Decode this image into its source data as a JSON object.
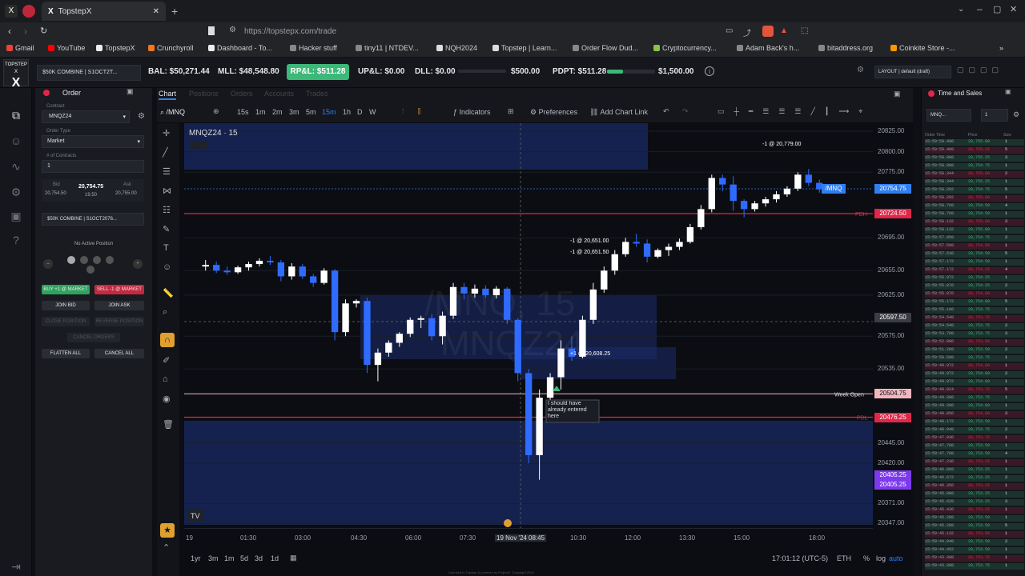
{
  "browser": {
    "tabs": [
      {
        "label": "TopstepX",
        "active": true
      }
    ],
    "url": "https://topstepx.com/trade",
    "bookmarks": [
      "Gmail",
      "YouTube",
      "TopstepX",
      "Crunchyroll",
      "Dashboard - To...",
      "Hacker stuff",
      "tiny11 | NTDEV...",
      "NQH2024",
      "Topstep | Learn...",
      "Order Flow Dud...",
      "Cryptocurrency...",
      "Adam Back's h...",
      "bitaddress.org",
      "Coinkite Store -..."
    ]
  },
  "appbar": {
    "logo": "TOPSTEP X",
    "account": "$50K COMBINE | S1OCT2T...",
    "bal": "BAL: $50,271.44",
    "mll": "MLL: $48,548.80",
    "rpl": "RP&L: $511.28",
    "upl": "UP&L: $0.00",
    "dll": "DLL: $0.00",
    "dll_limit": "$500.00",
    "pdpt": "PDPT: $511.28",
    "pdpt_target": "$1,500.00",
    "pdpt_progress": 0.34,
    "layout": "LAYOUT | default (draft)"
  },
  "order": {
    "title": "Order",
    "contract_label": "Contract",
    "contract": "MNQZ24",
    "order_type_label": "Order Type",
    "order_type": "Market",
    "qty_label": "# of Contracts",
    "qty": "1",
    "bid_label": "Bid",
    "bid": "20,754.50",
    "last": "20,754.75",
    "last_size": "19.50",
    "ask_label": "Ask",
    "ask": "20,755.00",
    "account": "$50K COMBINE | S1OCT2076...",
    "position": "No Active Position",
    "buy_btn": "BUY +1 @ MARKET",
    "sell_btn": "SELL -1 @ MARKET",
    "join_bid": "JOIN BID",
    "join_ask": "JOIN ASK",
    "close_pos": "CLOSE POSITION",
    "reverse_pos": "REVERSE POSITION",
    "cancel_orders": "CANCEL ORDERS",
    "flatten_all": "FLATTEN ALL",
    "cancel_all": "CANCEL ALL"
  },
  "chart": {
    "tabs": [
      "Chart",
      "Positions",
      "Orders",
      "Accounts",
      "Trades"
    ],
    "symbol": "/MNQ",
    "timeframes": [
      "15s",
      "1m",
      "2m",
      "3m",
      "5m",
      "15m",
      "1h",
      "D",
      "W"
    ],
    "indicators_label": "Indicators",
    "preferences_label": "Preferences",
    "add_chart_link_label": "Add Chart Link",
    "header": "MNQZ24 · 15",
    "watermark": "/MNQ, 15",
    "watermark2": "MNQZ24",
    "week_open_label": "Week Open",
    "pdh_label": "PDH",
    "pdl_label": "PDL",
    "note": "I should have already entered here",
    "trade_labels": [
      "-1 @ 20,779.00",
      "-1 @ 20,651.00",
      "-1 @ 20,651.50",
      "+1 @ 20,608.25"
    ],
    "bottom_ranges": [
      "1yr",
      "3m",
      "1m",
      "5d",
      "3d",
      "1d"
    ],
    "clock": "17:01:12 (UTC-5)",
    "session": "ETH",
    "pct": "%",
    "log": "log",
    "auto": "auto",
    "ylabels": [
      "20825.00",
      "20800.00",
      "20775.00",
      "20724.50",
      "20695.00",
      "20655.00",
      "20625.00",
      "20575.00",
      "20535.00",
      "20445.00",
      "20420.00",
      "20371.00",
      "20347.00"
    ],
    "price_tags": [
      {
        "label": "/MNQ",
        "value": "20754.75",
        "color": "#2f7ff0"
      },
      {
        "label": "PDH",
        "value": "20724.50",
        "color": "#e0274a"
      },
      {
        "label": "",
        "value": "20597.50",
        "color": "#3a3d45"
      },
      {
        "label": "Week Open",
        "value": "20504.75",
        "color": "#f2b6bf"
      },
      {
        "label": "PDL",
        "value": "20476.25",
        "color": "#e0274a"
      },
      {
        "label": "",
        "value": "20405.25",
        "color": "#7c3aed"
      },
      {
        "label": "",
        "value": "20405.25",
        "color": "#7c3aed"
      }
    ],
    "xlabels": [
      "19",
      "01:30",
      "03:00",
      "04:30",
      "06:00",
      "07:30",
      "19 Nov '24",
      "08:45",
      "10:30",
      "12:00",
      "13:30",
      "15:00",
      "18:00"
    ]
  },
  "chart_data": {
    "type": "candlestick",
    "title": "MNQZ24 · 15",
    "candles": [
      [
        20660,
        20668,
        20655,
        20662
      ],
      [
        20662,
        20666,
        20652,
        20655
      ],
      [
        20655,
        20660,
        20650,
        20653
      ],
      [
        20653,
        20661,
        20651,
        20659
      ],
      [
        20659,
        20666,
        20655,
        20663
      ],
      [
        20663,
        20670,
        20660,
        20667
      ],
      [
        20667,
        20673,
        20662,
        20665
      ],
      [
        20665,
        20668,
        20642,
        20648
      ],
      [
        20648,
        20664,
        20644,
        20660
      ],
      [
        20660,
        20663,
        20645,
        20648
      ],
      [
        20648,
        20651,
        20635,
        20640
      ],
      [
        20640,
        20658,
        20638,
        20655
      ],
      [
        20655,
        20657,
        20570,
        20580
      ],
      [
        20580,
        20620,
        20575,
        20615
      ],
      [
        20615,
        20620,
        20610,
        20618
      ],
      [
        20618,
        20622,
        20530,
        20540
      ],
      [
        20540,
        20560,
        20520,
        20555
      ],
      [
        20555,
        20570,
        20550,
        20567
      ],
      [
        20567,
        20580,
        20562,
        20578
      ],
      [
        20578,
        20598,
        20574,
        20595
      ],
      [
        20595,
        20600,
        20585,
        20597
      ],
      [
        20597,
        20602,
        20570,
        20575
      ],
      [
        20575,
        20605,
        20565,
        20600
      ],
      [
        20600,
        20640,
        20596,
        20635
      ],
      [
        20635,
        20640,
        20620,
        20627
      ],
      [
        20627,
        20638,
        20622,
        20633
      ],
      [
        20633,
        20637,
        20622,
        20625
      ],
      [
        20625,
        20636,
        20621,
        20633
      ],
      [
        20633,
        20635,
        20590,
        20595
      ],
      [
        20595,
        20597,
        20520,
        20530
      ],
      [
        20530,
        20535,
        20420,
        20430
      ],
      [
        20430,
        20510,
        20400,
        20500
      ],
      [
        20500,
        20530,
        20495,
        20525
      ],
      [
        20525,
        20570,
        20510,
        20560
      ],
      [
        20560,
        20575,
        20545,
        20550
      ],
      [
        20550,
        20600,
        20548,
        20595
      ],
      [
        20595,
        20640,
        20590,
        20632
      ],
      [
        20632,
        20660,
        20628,
        20655
      ],
      [
        20655,
        20680,
        20650,
        20675
      ],
      [
        20675,
        20695,
        20672,
        20690
      ],
      [
        20690,
        20700,
        20684,
        20688
      ],
      [
        20688,
        20693,
        20665,
        20672
      ],
      [
        20672,
        20682,
        20670,
        20680
      ],
      [
        20680,
        20688,
        20673,
        20684
      ],
      [
        20684,
        20694,
        20680,
        20690
      ],
      [
        20690,
        20712,
        20688,
        20708
      ],
      [
        20708,
        20735,
        20705,
        20730
      ],
      [
        20730,
        20772,
        20726,
        20768
      ],
      [
        20768,
        20772,
        20752,
        20760
      ],
      [
        20760,
        20770,
        20728,
        20740
      ],
      [
        20740,
        20742,
        20720,
        20730
      ],
      [
        20730,
        20740,
        20727,
        20737
      ],
      [
        20737,
        20745,
        20733,
        20742
      ],
      [
        20742,
        20752,
        20738,
        20748
      ],
      [
        20748,
        20758,
        20745,
        20755
      ],
      [
        20755,
        20775,
        20752,
        20772
      ],
      [
        20772,
        20779,
        20758,
        20762
      ],
      [
        20762,
        20766,
        20750,
        20754
      ]
    ],
    "ylim": [
      20347,
      20825
    ],
    "xlabel": "",
    "ylabel": ""
  },
  "tns": {
    "title": "Time and Sales",
    "contract": "MNQ...",
    "size_box": "1",
    "headers": [
      "Order Time",
      "Price",
      "Size"
    ],
    "rows": [
      [
        "15:59:59.496",
        "20,755.00",
        "1"
      ],
      [
        "15:59:59.460",
        "20,755.25",
        "5"
      ],
      [
        "15:59:58.908",
        "20,755.25",
        "3"
      ],
      [
        "15:59:58.908",
        "20,754.75",
        "1"
      ],
      [
        "15:59:58.344",
        "20,755.00",
        "2"
      ],
      [
        "15:59:58.344",
        "20,755.25",
        "1"
      ],
      [
        "15:59:58.292",
        "20,754.75",
        "5"
      ],
      [
        "15:59:58.292",
        "20,755.00",
        "1"
      ],
      [
        "15:59:58.760",
        "20,754.50",
        "4"
      ],
      [
        "15:59:58.760",
        "20,754.50",
        "1"
      ],
      [
        "15:59:58.132",
        "20,755.00",
        "3"
      ],
      [
        "15:59:58.132",
        "20,755.00",
        "1"
      ],
      [
        "15:59:57.950",
        "20,754.75",
        "2"
      ],
      [
        "15:59:57.590",
        "20,754.50",
        "1"
      ],
      [
        "15:59:57.536",
        "20,754.50",
        "5"
      ],
      [
        "15:59:57.172",
        "20,754.50",
        "1"
      ],
      [
        "15:59:57.172",
        "20,754.25",
        "4"
      ],
      [
        "15:59:56.972",
        "20,754.25",
        "1"
      ],
      [
        "15:59:55.876",
        "20,754.25",
        "2"
      ],
      [
        "15:59:55.876",
        "20,754.00",
        "1"
      ],
      [
        "15:59:55.172",
        "20,754.00",
        "5"
      ],
      [
        "15:59:55.196",
        "20,753.75",
        "1"
      ],
      [
        "15:59:54.548",
        "20,753.75",
        "1"
      ],
      [
        "15:59:54.548",
        "20,753.75",
        "2"
      ],
      [
        "15:59:53.780",
        "20,753.75",
        "3"
      ],
      [
        "15:59:52.996",
        "20,753.50",
        "1"
      ],
      [
        "15:59:51.260",
        "20,753.50",
        "2"
      ],
      [
        "15:59:50.500",
        "20,753.75",
        "1"
      ],
      [
        "15:59:49.972",
        "20,754.00",
        "1"
      ],
      [
        "15:59:49.972",
        "20,754.00",
        "2"
      ],
      [
        "15:59:49.972",
        "20,754.00",
        "1"
      ],
      [
        "15:59:49.924",
        "20,753.75",
        "5"
      ],
      [
        "15:59:49.396",
        "20,753.75",
        "1"
      ],
      [
        "15:59:49.396",
        "20,754.00",
        "1"
      ],
      [
        "15:59:48.856",
        "20,754.00",
        "3"
      ],
      [
        "15:59:48.172",
        "20,753.50",
        "1"
      ],
      [
        "15:59:48.048",
        "20,753.75",
        "2"
      ],
      [
        "15:59:47.936",
        "20,753.75",
        "1"
      ],
      [
        "15:59:47.788",
        "20,753.50",
        "1"
      ],
      [
        "15:59:47.788",
        "20,753.50",
        "4"
      ],
      [
        "15:59:47.236",
        "20,753.25",
        "1"
      ],
      [
        "15:59:46.860",
        "20,753.25",
        "1"
      ],
      [
        "15:59:46.672",
        "20,753.25",
        "2"
      ],
      [
        "15:59:46.356",
        "20,753.25",
        "1"
      ],
      [
        "15:59:45.980",
        "20,753.25",
        "1"
      ],
      [
        "15:59:45.620",
        "20,753.25",
        "3"
      ],
      [
        "15:59:45.436",
        "20,753.25",
        "1"
      ],
      [
        "15:59:45.288",
        "20,753.50",
        "1"
      ],
      [
        "15:59:45.288",
        "20,753.50",
        "5"
      ],
      [
        "15:59:45.132",
        "20,753.50",
        "1"
      ],
      [
        "15:59:44.940",
        "20,753.50",
        "2"
      ],
      [
        "15:59:44.452",
        "20,753.50",
        "1"
      ],
      [
        "15:59:43.308",
        "20,753.75",
        "1"
      ],
      [
        "15:59:43.308",
        "20,753.75",
        "1"
      ]
    ]
  },
  "footer": "Licensed to Topstep & powered by ProjectX. Copyright 2024"
}
